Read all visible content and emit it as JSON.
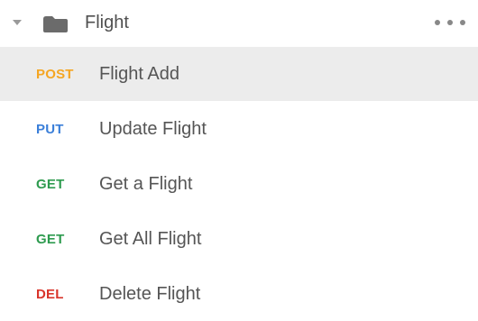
{
  "folder": {
    "name": "Flight",
    "icons": {
      "caret": "caret-down-icon",
      "folder": "folder-icon",
      "more": "more-horizontal-icon"
    }
  },
  "requests": [
    {
      "method": "POST",
      "name": "Flight Add",
      "color": "#f5a623",
      "selected": true
    },
    {
      "method": "PUT",
      "name": "Update Flight",
      "color": "#3b7fd9",
      "selected": false
    },
    {
      "method": "GET",
      "name": "Get a Flight",
      "color": "#2e9b4f",
      "selected": false
    },
    {
      "method": "GET",
      "name": "Get All Flight",
      "color": "#2e9b4f",
      "selected": false
    },
    {
      "method": "DEL",
      "name": "Delete Flight",
      "color": "#d9352b",
      "selected": false
    }
  ],
  "colors": {
    "selected_bg": "#ececec",
    "text": "#555555",
    "icon": "#6b6b6b"
  }
}
